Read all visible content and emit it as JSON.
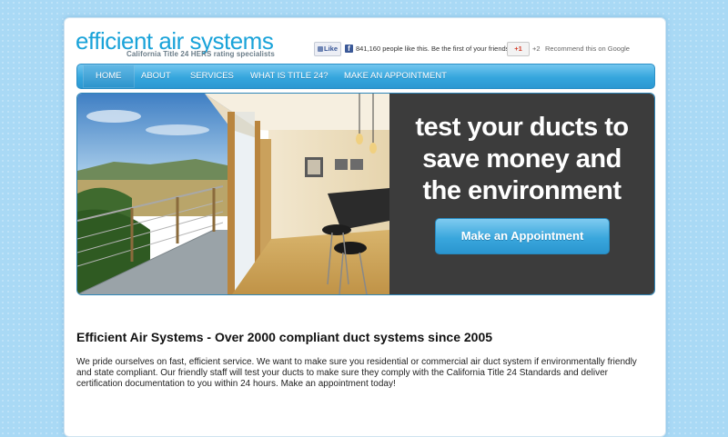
{
  "logo": {
    "title": "efficient air systems",
    "tagline": "California Title 24 HERS rating specialists"
  },
  "social": {
    "fb_like_label": "Like",
    "fb_text": "841,160 people like this. Be the first of your friends.",
    "gplus_label": "+1",
    "gplus_count": "+2",
    "gplus_text": "Recommend this on Google"
  },
  "nav": {
    "items": [
      {
        "label": "HOME"
      },
      {
        "label": "ABOUT"
      },
      {
        "label": "SERVICES"
      },
      {
        "label": "WHAT IS TITLE 24?"
      },
      {
        "label": "MAKE AN APPOINTMENT"
      }
    ]
  },
  "hero": {
    "headline_line1": "test your ducts to",
    "headline_line2": "save money and",
    "headline_line3": "the environment",
    "cta_label": "Make an Appointment"
  },
  "content": {
    "title": "Efficient Air Systems - Over 2000 compliant duct systems since 2005",
    "body": "We pride ourselves on fast, efficient service. We want to make sure you residential or commercial air duct system if environmentally friendly and state compliant. Our friendly staff will test your ducts to make sure they comply with the California Title 24 Standards and deliver certification documentation to you within 24 hours. Make an appointment today!"
  },
  "colors": {
    "accent": "#1aa3d9",
    "nav": "#35a6dd",
    "panel": "#3c3c3c"
  }
}
